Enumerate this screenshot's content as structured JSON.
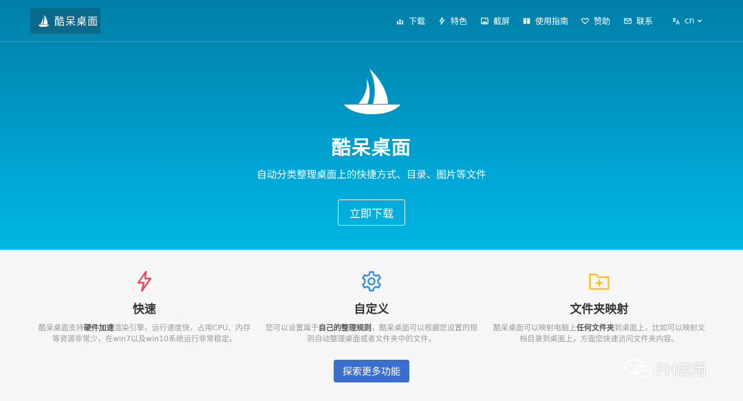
{
  "brand": {
    "name": "酷呆桌面",
    "icon": "sailboat-icon"
  },
  "nav": [
    {
      "label": "下载",
      "icon": "download-icon"
    },
    {
      "label": "特色",
      "icon": "bolt-icon"
    },
    {
      "label": "截屏",
      "icon": "image-icon"
    },
    {
      "label": "使用指南",
      "icon": "book-icon"
    },
    {
      "label": "赞助",
      "icon": "heart-icon"
    },
    {
      "label": "联系",
      "icon": "mail-icon"
    },
    {
      "label": "cn",
      "icon": "translate-icon"
    }
  ],
  "hero": {
    "title": "酷呆桌面",
    "subtitle": "自动分类整理桌面上的快捷方式、目录、图片等文件",
    "download_label": "立即下载"
  },
  "features": [
    {
      "title": "快速",
      "icon": "bolt-icon",
      "color": "#e8495f",
      "desc_pre": "酷呆桌面支持",
      "desc_bold": "硬件加速",
      "desc_post": "渲染引擎，运行速度快，占用CPU、内存等资源非常少，在win7以及win10系统运行非常稳定。"
    },
    {
      "title": "自定义",
      "icon": "gear-icon",
      "color": "#3b8fd9",
      "desc_pre": "您可以设置属于",
      "desc_bold": "自己的整理规则",
      "desc_post": "，酷呆桌面可以根据您设置的规则自动整理桌面或者文件夹中的文件。"
    },
    {
      "title": "文件夹映射",
      "icon": "folder-plus-icon",
      "color": "#f5c324",
      "desc_pre": "酷呆桌面可以映射电脑上",
      "desc_bold": "任何文件夹",
      "desc_post": "到桌面上，比如可以映射文档目录到桌面上，方面您快速访问文件夹内容。"
    }
  ],
  "more_button": "探索更多功能",
  "watermark": "FH应用",
  "colors": {
    "hero_top": "#007fa8",
    "hero_bottom": "#00b5e2",
    "primary_button": "#3a6fcf"
  }
}
